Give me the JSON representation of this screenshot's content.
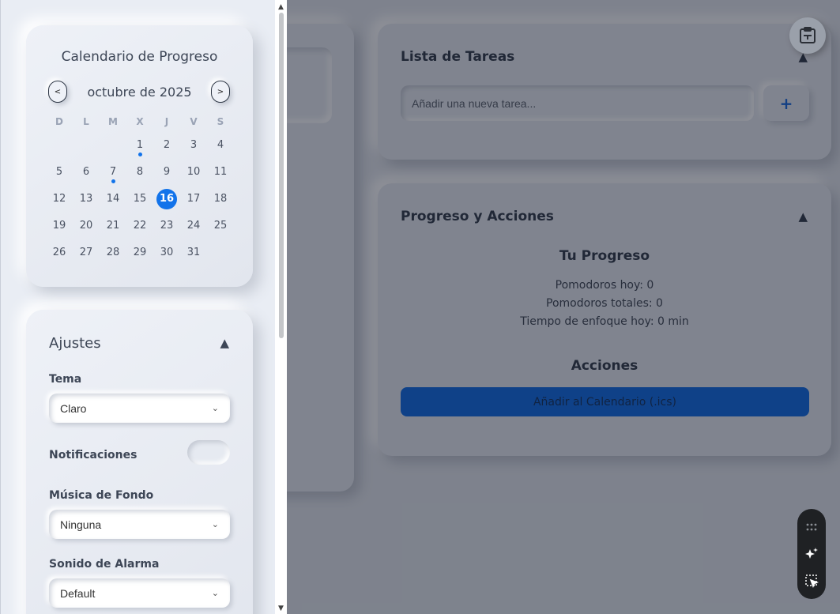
{
  "app": {
    "tasks": {
      "title": "Lista de Tareas",
      "input_placeholder": "Añadir una nueva tarea...",
      "add_label": "+"
    },
    "progress": {
      "title": "Progreso y Acciones",
      "subtitle": "Tu Progreso",
      "pomodoros_today": "Pomodoros hoy: 0",
      "pomodoros_total": "Pomodoros totales: 0",
      "focus_today": "Tiempo de enfoque hoy: 0 min",
      "actions_title": "Acciones",
      "calendar_button": "Añadir al Calendario (.ics)"
    }
  },
  "calendar": {
    "title": "Calendario de Progreso",
    "month_label": "octubre de 2025",
    "prev_label": "<",
    "next_label": ">",
    "weekdays": [
      "D",
      "L",
      "M",
      "X",
      "J",
      "V",
      "S"
    ],
    "leading_blanks": 3,
    "days_in_month": 31,
    "today": 16,
    "days_with_activity": [
      1,
      7
    ]
  },
  "settings": {
    "title": "Ajustes",
    "theme_label": "Tema",
    "theme_value": "Claro",
    "notifications_label": "Notificaciones",
    "notifications_on": false,
    "music_label": "Música de Fondo",
    "music_value": "Ninguna",
    "alarm_label": "Sonido de Alarma",
    "alarm_value": "Default"
  },
  "colors": {
    "accent": "#1273ea",
    "button": "#0a66e0"
  },
  "icons": {
    "top_right": "clipboard-icon",
    "toolbar": [
      "grid-dots-icon",
      "sparkle-icon",
      "select-area-icon"
    ],
    "collapse": "triangle-up-icon"
  }
}
